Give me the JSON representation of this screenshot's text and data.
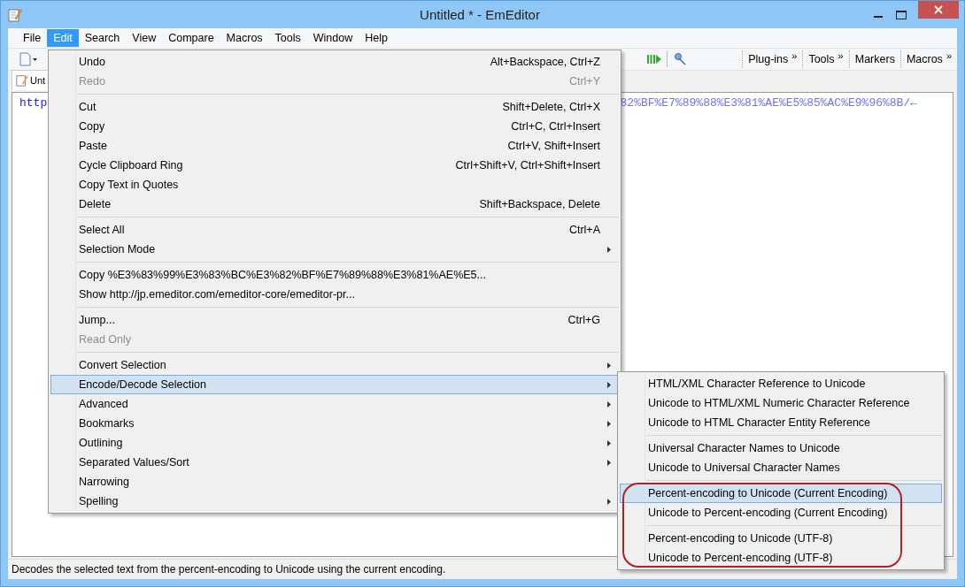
{
  "window": {
    "title": "Untitled * - EmEditor"
  },
  "menubar": [
    {
      "label": "File",
      "selected": false
    },
    {
      "label": "Edit",
      "selected": true
    },
    {
      "label": "Search",
      "selected": false
    },
    {
      "label": "View",
      "selected": false
    },
    {
      "label": "Compare",
      "selected": false
    },
    {
      "label": "Macros",
      "selected": false
    },
    {
      "label": "Tools",
      "selected": false
    },
    {
      "label": "Window",
      "selected": false
    },
    {
      "label": "Help",
      "selected": false
    }
  ],
  "toolbar": {
    "bands": [
      {
        "label": "Plug-ins",
        "chevron": "»"
      },
      {
        "label": "Tools",
        "chevron": "»"
      },
      {
        "label": "Markers"
      },
      {
        "label": "Macros",
        "chevron": "»"
      }
    ]
  },
  "document_tab": {
    "label": "Unt"
  },
  "editor": {
    "line_start": "http",
    "line_end": "82%BF%E7%89%88%E3%81%AE%E5%85%AC%E9%96%8B/",
    "line_end_mark": "←"
  },
  "edit_menu": [
    {
      "kind": "item",
      "label": "Undo",
      "shortcut": "Alt+Backspace, Ctrl+Z",
      "disabled": false,
      "selected": false,
      "submenu": false
    },
    {
      "kind": "item",
      "label": "Redo",
      "shortcut": "Ctrl+Y",
      "disabled": true,
      "selected": false,
      "submenu": false
    },
    {
      "kind": "separator"
    },
    {
      "kind": "item",
      "label": "Cut",
      "shortcut": "Shift+Delete, Ctrl+X",
      "disabled": false,
      "selected": false,
      "submenu": false
    },
    {
      "kind": "item",
      "label": "Copy",
      "shortcut": "Ctrl+C, Ctrl+Insert",
      "disabled": false,
      "selected": false,
      "submenu": false
    },
    {
      "kind": "item",
      "label": "Paste",
      "shortcut": "Ctrl+V, Shift+Insert",
      "disabled": false,
      "selected": false,
      "submenu": false
    },
    {
      "kind": "item",
      "label": "Cycle Clipboard Ring",
      "shortcut": "Ctrl+Shift+V, Ctrl+Shift+Insert",
      "disabled": false,
      "selected": false,
      "submenu": false
    },
    {
      "kind": "item",
      "label": "Copy Text in Quotes",
      "disabled": false,
      "selected": false,
      "submenu": false
    },
    {
      "kind": "item",
      "label": "Delete",
      "shortcut": "Shift+Backspace, Delete",
      "disabled": false,
      "selected": false,
      "submenu": false
    },
    {
      "kind": "separator"
    },
    {
      "kind": "item",
      "label": "Select All",
      "shortcut": "Ctrl+A",
      "disabled": false,
      "selected": false,
      "submenu": false
    },
    {
      "kind": "item",
      "label": "Selection Mode",
      "disabled": false,
      "selected": false,
      "submenu": true
    },
    {
      "kind": "separator"
    },
    {
      "kind": "item",
      "label": "Copy %E3%83%99%E3%83%BC%E3%82%BF%E7%89%88%E3%81%AE%E5...",
      "disabled": false,
      "selected": false,
      "submenu": false
    },
    {
      "kind": "item",
      "label": "Show http://jp.emeditor.com/emeditor-core/emeditor-pr...",
      "disabled": false,
      "selected": false,
      "submenu": false
    },
    {
      "kind": "separator"
    },
    {
      "kind": "item",
      "label": "Jump...",
      "shortcut": "Ctrl+G",
      "disabled": false,
      "selected": false,
      "submenu": false
    },
    {
      "kind": "item",
      "label": "Read Only",
      "disabled": true,
      "selected": false,
      "submenu": false
    },
    {
      "kind": "separator"
    },
    {
      "kind": "item",
      "label": "Convert Selection",
      "disabled": false,
      "selected": false,
      "submenu": true
    },
    {
      "kind": "item",
      "label": "Encode/Decode Selection",
      "disabled": false,
      "selected": true,
      "submenu": true
    },
    {
      "kind": "item",
      "label": "Advanced",
      "disabled": false,
      "selected": false,
      "submenu": true
    },
    {
      "kind": "item",
      "label": "Bookmarks",
      "disabled": false,
      "selected": false,
      "submenu": true
    },
    {
      "kind": "item",
      "label": "Outlining",
      "disabled": false,
      "selected": false,
      "submenu": true
    },
    {
      "kind": "item",
      "label": "Separated Values/Sort",
      "disabled": false,
      "selected": false,
      "submenu": true
    },
    {
      "kind": "item",
      "label": "Narrowing",
      "disabled": false,
      "selected": false,
      "submenu": false
    },
    {
      "kind": "item",
      "label": "Spelling",
      "disabled": false,
      "selected": false,
      "submenu": true
    }
  ],
  "encode_submenu": [
    {
      "kind": "item",
      "label": "HTML/XML Character Reference to Unicode",
      "selected": false
    },
    {
      "kind": "item",
      "label": "Unicode to HTML/XML Numeric Character Reference",
      "selected": false
    },
    {
      "kind": "item",
      "label": "Unicode to HTML Character Entity Reference",
      "selected": false
    },
    {
      "kind": "separator"
    },
    {
      "kind": "item",
      "label": "Universal Character Names to Unicode",
      "selected": false
    },
    {
      "kind": "item",
      "label": "Unicode to Universal Character Names",
      "selected": false
    },
    {
      "kind": "separator"
    },
    {
      "kind": "item",
      "label": "Percent-encoding to Unicode (Current Encoding)",
      "selected": true
    },
    {
      "kind": "item",
      "label": "Unicode to Percent-encoding (Current Encoding)",
      "selected": false
    },
    {
      "kind": "separator"
    },
    {
      "kind": "item",
      "label": "Percent-encoding to Unicode (UTF-8)",
      "selected": false
    },
    {
      "kind": "item",
      "label": "Unicode to Percent-encoding (UTF-8)",
      "selected": false
    }
  ],
  "status_bar": {
    "text": "Decodes the selected text from the percent-encoding to Unicode using the current encoding."
  }
}
